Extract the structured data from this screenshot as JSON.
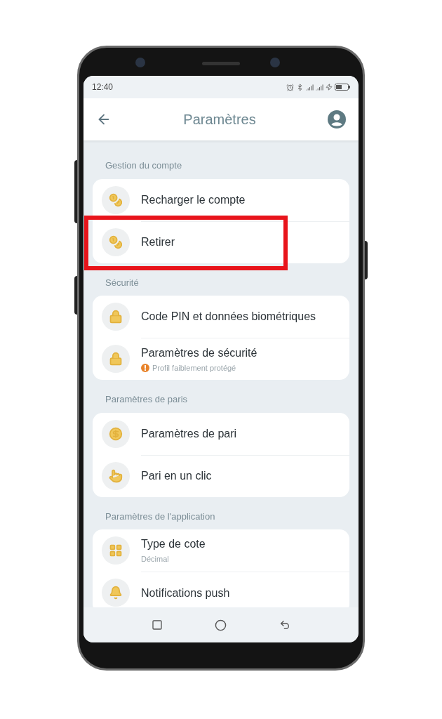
{
  "status_bar": {
    "time": "12:40"
  },
  "header": {
    "title": "Paramètres"
  },
  "sections": [
    {
      "title": "Gestion du compte",
      "items": [
        {
          "label": "Recharger le compte",
          "highlighted": false
        },
        {
          "label": "Retirer",
          "highlighted": true
        }
      ]
    },
    {
      "title": "Sécurité",
      "items": [
        {
          "label": "Code PIN et données biométriques",
          "highlighted": false
        },
        {
          "label": "Paramètres de sécurité",
          "subtitle": {
            "text": "Profil faiblement protégé",
            "kind": "warning"
          },
          "highlighted": false
        }
      ]
    },
    {
      "title": "Paramètres de paris",
      "items": [
        {
          "label": "Paramètres de pari",
          "highlighted": false
        },
        {
          "label": "Pari en un clic",
          "highlighted": false
        }
      ]
    },
    {
      "title": "Paramètres de l'application",
      "items": [
        {
          "label": "Type de cote",
          "subtitle": {
            "text": "Décimal",
            "kind": "plain"
          },
          "highlighted": false
        },
        {
          "label": "Notifications push",
          "highlighted": false
        }
      ]
    }
  ]
}
